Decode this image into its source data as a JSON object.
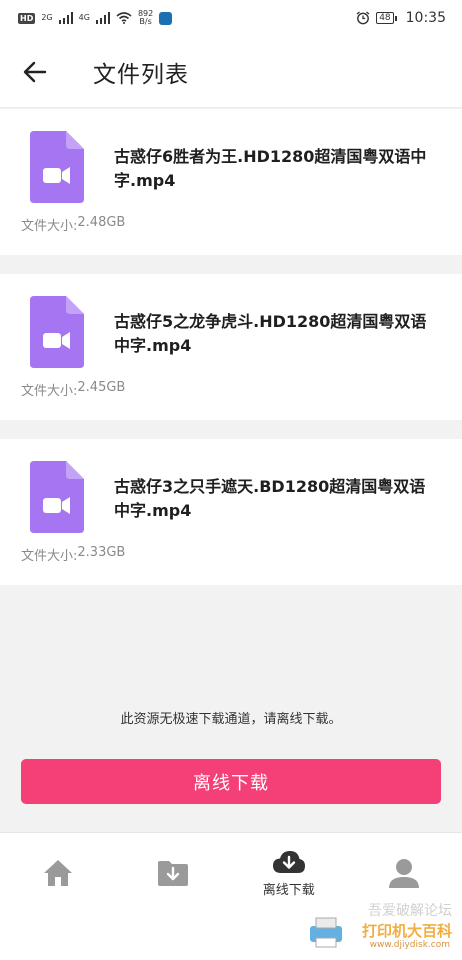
{
  "status_bar": {
    "chip_label": "HD",
    "net1": "2G",
    "net2": "4G",
    "speed_value": "892",
    "speed_unit": "B/s",
    "battery": "48",
    "time": "10:35"
  },
  "header": {
    "title": "文件列表"
  },
  "files": [
    {
      "name": "古惑仔6胜者为王.HD1280超清国粤双语中字.mp4",
      "size_label": "文件大小: ",
      "size": "2.48GB"
    },
    {
      "name": "古惑仔5之龙争虎斗.HD1280超清国粤双语中字.mp4",
      "size_label": "文件大小: ",
      "size": "2.45GB"
    },
    {
      "name": "古惑仔3之只手遮天.BD1280超清国粤双语中字.mp4",
      "size_label": "文件大小: ",
      "size": "2.33GB"
    }
  ],
  "notice": "此资源无极速下载通道，请离线下载。",
  "download_button": "离线下载",
  "bottom_nav": {
    "items": [
      {
        "icon": "home-icon",
        "label": ""
      },
      {
        "icon": "folder-download-icon",
        "label": ""
      },
      {
        "icon": "cloud-download-icon",
        "label": "离线下载"
      },
      {
        "icon": "user-icon",
        "label": ""
      }
    ]
  },
  "watermark": {
    "line1": "吾爱破解论坛",
    "line2": "打印机大百科",
    "line3": "www.djiydisk.com"
  },
  "colors": {
    "accent": "#f43f77",
    "file_icon": "#a675f2",
    "nav_icon": "#9a9a9a",
    "nav_active": "#333333"
  }
}
